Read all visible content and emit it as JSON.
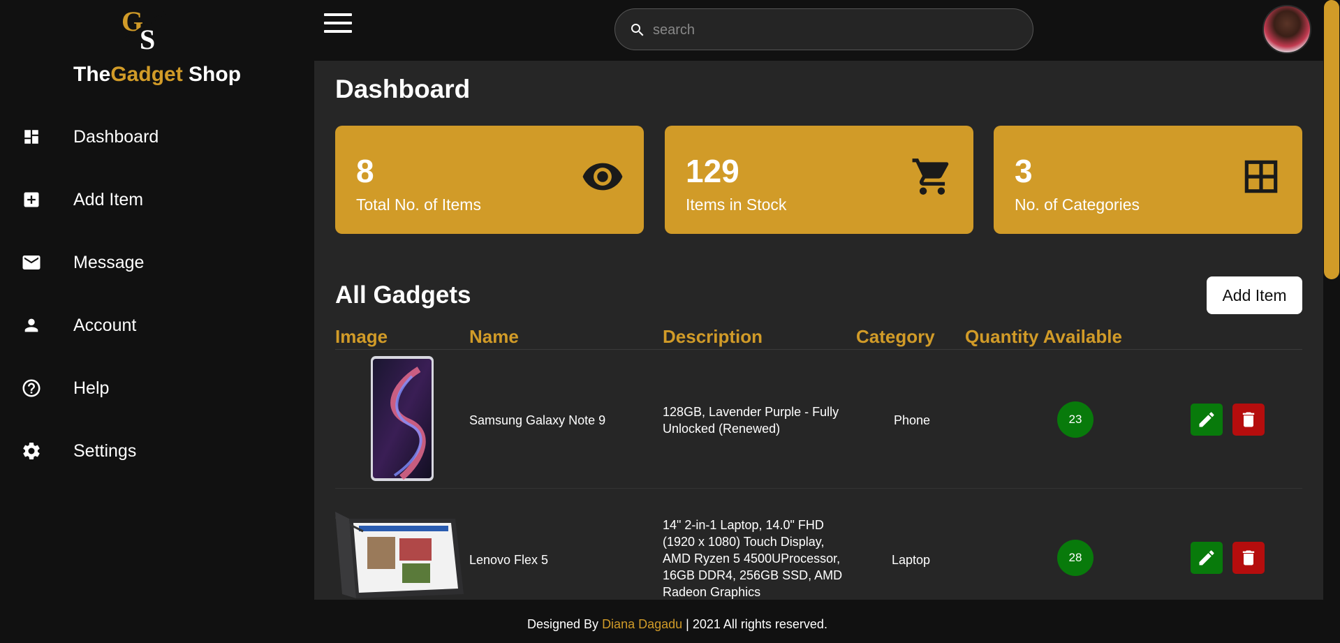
{
  "brand": {
    "logo_text": "GS",
    "name_prefix": "The",
    "name_accent": "Gadget",
    "name_suffix": " Shop"
  },
  "sidebar": {
    "items": [
      {
        "label": "Dashboard",
        "icon": "dashboard-icon"
      },
      {
        "label": "Add Item",
        "icon": "add-box-icon"
      },
      {
        "label": "Message",
        "icon": "mail-icon"
      },
      {
        "label": "Account",
        "icon": "person-icon"
      },
      {
        "label": "Help",
        "icon": "help-icon"
      },
      {
        "label": "Settings",
        "icon": "gear-icon"
      }
    ]
  },
  "header": {
    "search_placeholder": "search"
  },
  "main": {
    "title": "Dashboard",
    "stats": [
      {
        "value": "8",
        "label": "Total No. of Items",
        "icon": "eye-icon"
      },
      {
        "value": "129",
        "label": "Items in Stock",
        "icon": "cart-icon"
      },
      {
        "value": "3",
        "label": "No. of Categories",
        "icon": "grid-icon"
      }
    ],
    "section_title": "All Gadgets",
    "add_button": "Add Item",
    "table": {
      "headers": [
        "Image",
        "Name",
        "Description",
        "Category",
        "Quantity Available"
      ],
      "rows": [
        {
          "name": "Samsung Galaxy Note 9",
          "description": "128GB, Lavender Purple - Fully Unlocked (Renewed)",
          "category": "Phone",
          "quantity": "23"
        },
        {
          "name": "Lenovo Flex 5",
          "description": "14\" 2-in-1 Laptop, 14.0\" FHD (1920 x 1080) Touch Display, AMD Ryzen 5 4500UProcessor, 16GB DDR4, 256GB SSD, AMD Radeon Graphics",
          "category": "Laptop",
          "quantity": "28"
        }
      ]
    }
  },
  "footer": {
    "prefix": "Designed By ",
    "author": "Diana Dagadu",
    "suffix": " | 2021 All rights reserved."
  },
  "colors": {
    "accent": "#d19b28",
    "background": "#111111",
    "panel": "#262626",
    "success": "#087a0b",
    "danger": "#b50d0d"
  }
}
